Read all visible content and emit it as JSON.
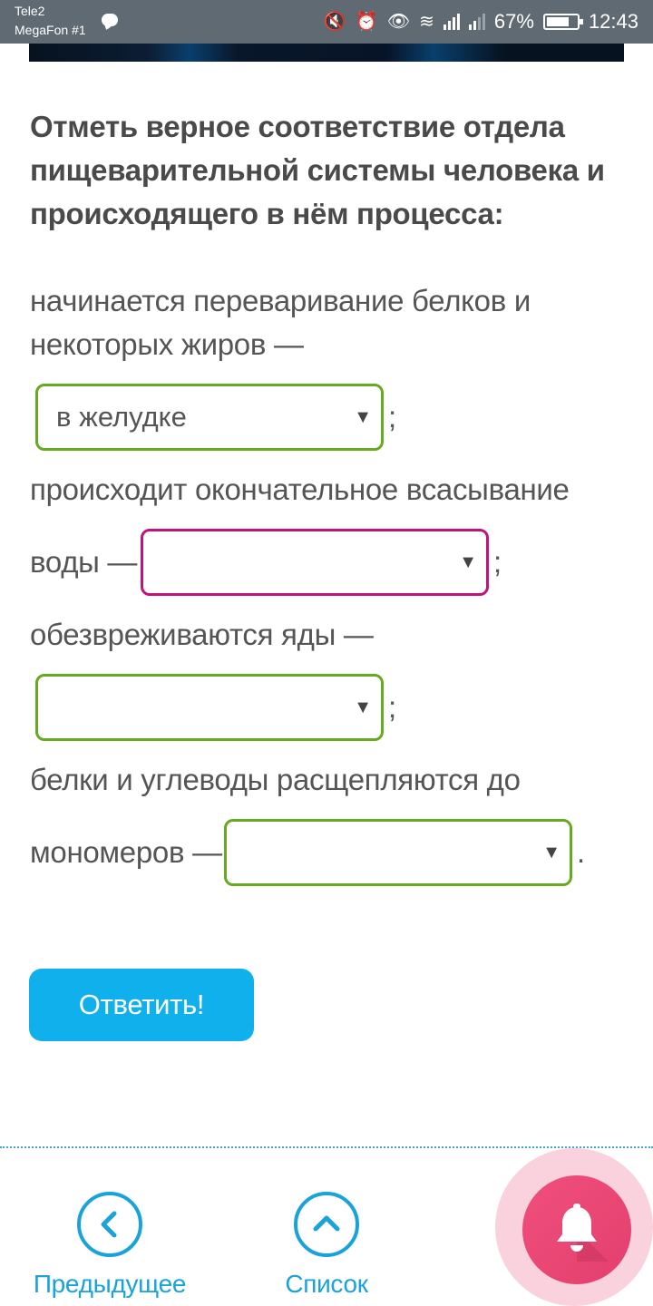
{
  "status_bar": {
    "carrier_1": "Tele2",
    "carrier_2": "MegaFon #1",
    "battery": "67%",
    "time": "12:43"
  },
  "question": {
    "title": "Отметь верное соответствие отдела пищеварительной системы человека и происходящего в нём процесса:"
  },
  "items": [
    {
      "text_line1": "начинается переваривание белков и",
      "text_line2": "некоторых жиров —",
      "selected": "в желудке",
      "punct": ";"
    },
    {
      "text_line1": "происходит окончательное всасывание",
      "text_line2": "воды —",
      "selected": "",
      "punct": ";"
    },
    {
      "text_line1": "обезвреживаются яды —",
      "selected": "",
      "punct": ";"
    },
    {
      "text_line1": "белки и углеводы расщепляются до",
      "text_line2": "мономеров —",
      "selected": "",
      "punct": "."
    }
  ],
  "colors": {
    "correct_border": "#66aa1f",
    "wrong_border": "#c0147c",
    "button": "#10b0ec",
    "nav": "#1aa3da",
    "bell": "#e8456f"
  },
  "answer_button": {
    "label": "Ответить!"
  },
  "bottom_nav": {
    "prev_label": "Предыдущее",
    "list_label": "Список",
    "prev_icon": "chevron-left-icon",
    "list_icon": "chevron-up-icon",
    "bell_icon": "bell-icon"
  }
}
